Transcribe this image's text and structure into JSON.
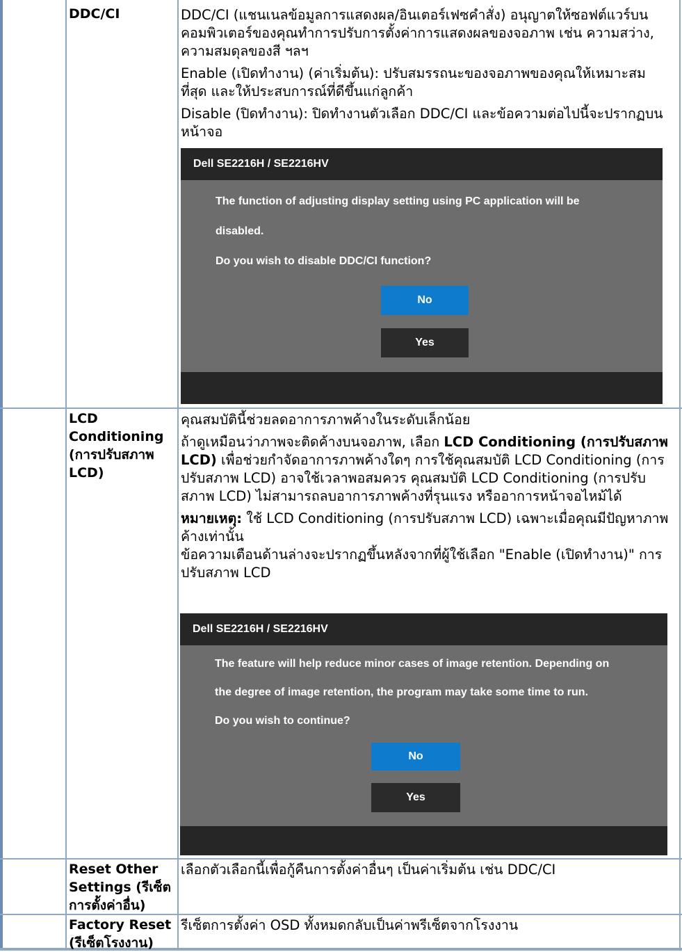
{
  "rows": {
    "ddc": {
      "label": "DDC/CI",
      "p1": "DDC/CI (แชนเนลข้อมูลการแสดงผล/อินเตอร์เฟซคำสั่ง) อนุญาตให้ซอฟต์แวร์บนคอมพิวเตอร์ของคุณทำการปรับการตั้งค่าการแสดงผลของจอภาพ เช่น ความสว่าง, ความสมดุลของสี ฯลฯ",
      "p2": "Enable (เปิดทำงาน) (ค่าเริ่มต้น): ปรับสมรรถนะของจอภาพของคุณให้เหมาะสมที่สุด และให้ประสบการณ์ที่ดีขึ้นแก่ลูกค้า",
      "p3": "Disable (ปิดทำงาน): ปิดทำงานตัวเลือก DDC/CI และข้อความต่อไปนี้จะปรากฏบนหน้าจอ",
      "dialog": {
        "title": "Dell SE2216H / SE2216HV",
        "line1": "The function of adjusting display setting using PC application will be",
        "line2": "disabled.",
        "line3": "Do you wish to disable DDC/CI function?",
        "no": "No",
        "yes": "Yes"
      }
    },
    "lcd": {
      "label_line1": "LCD",
      "label_line2": "Conditioning",
      "label_line3": "(การปรับสภาพ",
      "label_line4": "LCD)",
      "p1": "คุณสมบัตินี้ช่วยลดอาการภาพค้างในระดับเล็กน้อย",
      "p2_a": "ถ้าดูเหมือนว่าภาพจะติดค้างบนจอภาพ, เลือก ",
      "p2_bold": "LCD Conditioning (การปรับสภาพ LCD)",
      "p2_b": " เพื่อช่วยกำจัดอาการภาพค้างใดๆ การใช้คุณสมบัติ LCD Conditioning (การปรับสภาพ LCD) อาจใช้เวลาพอสมควร คุณสมบัติ LCD Conditioning (การปรับสภาพ LCD) ไม่สามารถลบอาการภาพค้างที่รุนแรง หรืออาการหน้าจอไหม้ได้",
      "note_bold": "หมายเหตุ:",
      "note_text": " ใช้ LCD Conditioning (การปรับสภาพ LCD) เฉพาะเมื่อคุณมีปัญหาภาพค้างเท่านั้น",
      "p4": "ข้อความเตือนด้านล่างจะปรากฏขึ้นหลังจากที่ผู้ใช้เลือก \"Enable (เปิดทำงาน)\" การปรับสภาพ LCD",
      "dialog": {
        "title": "Dell SE2216H / SE2216HV",
        "line1": "The feature will help reduce minor cases of image retention. Depending on",
        "line2": "the degree of image retention, the program may take some time to run.",
        "line3": "Do you wish to continue?",
        "no": "No",
        "yes": "Yes"
      }
    },
    "reset_other": {
      "label_line1": "Reset Other",
      "label_line2": "Settings (รีเซ็ต",
      "label_line3": "การตั้งค่าอื่น)",
      "text": "เลือกตัวเลือกนี้เพื่อกู้คืนการตั้งค่าอื่นๆ เป็นค่าเริ่มต้น เช่น DDC/CI"
    },
    "factory_reset": {
      "label_line1": "Factory Reset",
      "label_line2": "(รีเซ็ตโรงงาน)",
      "text": "รีเซ็ตการตั้งค่า OSD ทั้งหมดกลับเป็นค่าพรีเซ็ตจากโรงงาน"
    }
  },
  "colors": {
    "border": "#8fa8c6",
    "dialog_bg": "#6d6d6d",
    "dialog_bar": "#262626",
    "no_button": "#0f7bcc",
    "yes_button": "#2b2b2b"
  }
}
